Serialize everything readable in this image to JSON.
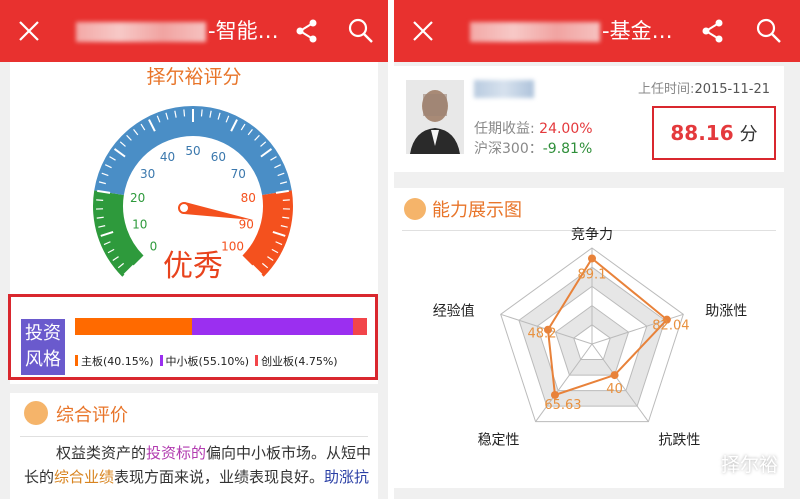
{
  "left": {
    "title_suffix": "-智能…",
    "score_card_title": "择尔裕评分",
    "gauge": {
      "ticks": [
        "0",
        "10",
        "20",
        "30",
        "40",
        "50",
        "60",
        "70",
        "80",
        "90",
        "100"
      ],
      "score": 88.16,
      "rating": "优秀"
    },
    "style": {
      "label_line1": "投资",
      "label_line2": "风格",
      "segments": [
        {
          "name": "主板",
          "pct": 40.15,
          "text": "主板(40.15%)",
          "color": "#ff6a00"
        },
        {
          "name": "中小板",
          "pct": 55.1,
          "text": "中小板(55.10%)",
          "color": "#9b2ff0"
        },
        {
          "name": "创业板",
          "pct": 4.75,
          "text": "创业板(4.75%)",
          "color": "#f2454a"
        }
      ]
    },
    "evaluation": {
      "heading": "综合评价",
      "text_a": "权益类资产的",
      "text_b": "投资标的",
      "text_c": "偏向中小板市场。从短中长的",
      "text_d": "综合业绩",
      "text_e": "表现方面来说，业绩表现良好。",
      "text_f": "助涨抗"
    }
  },
  "right": {
    "title_suffix": "-基金…",
    "since_label": "上任时间:",
    "since_value": "2015-11-21",
    "return_label": "任期收益:",
    "return_value": "24.00%",
    "hs300_label": "沪深300：",
    "hs300_value": "-9.81%",
    "score_value": "88.16",
    "score_unit": "分",
    "radar_heading": "能力展示图",
    "chart_data": {
      "type": "radar",
      "axes": [
        "竞争力",
        "助涨性",
        "抗跌性",
        "稳定性",
        "经验值"
      ],
      "values": [
        89.1,
        82.04,
        40,
        65.63,
        48.2
      ],
      "value_labels": [
        "89.1",
        "82.04",
        "40",
        "65.63",
        "48.2"
      ],
      "max": 100,
      "series_color": "#e8823a"
    }
  },
  "watermark": "择尔裕",
  "colors": {
    "accent": "#e8312f",
    "highlight_box": "#d9272e"
  }
}
